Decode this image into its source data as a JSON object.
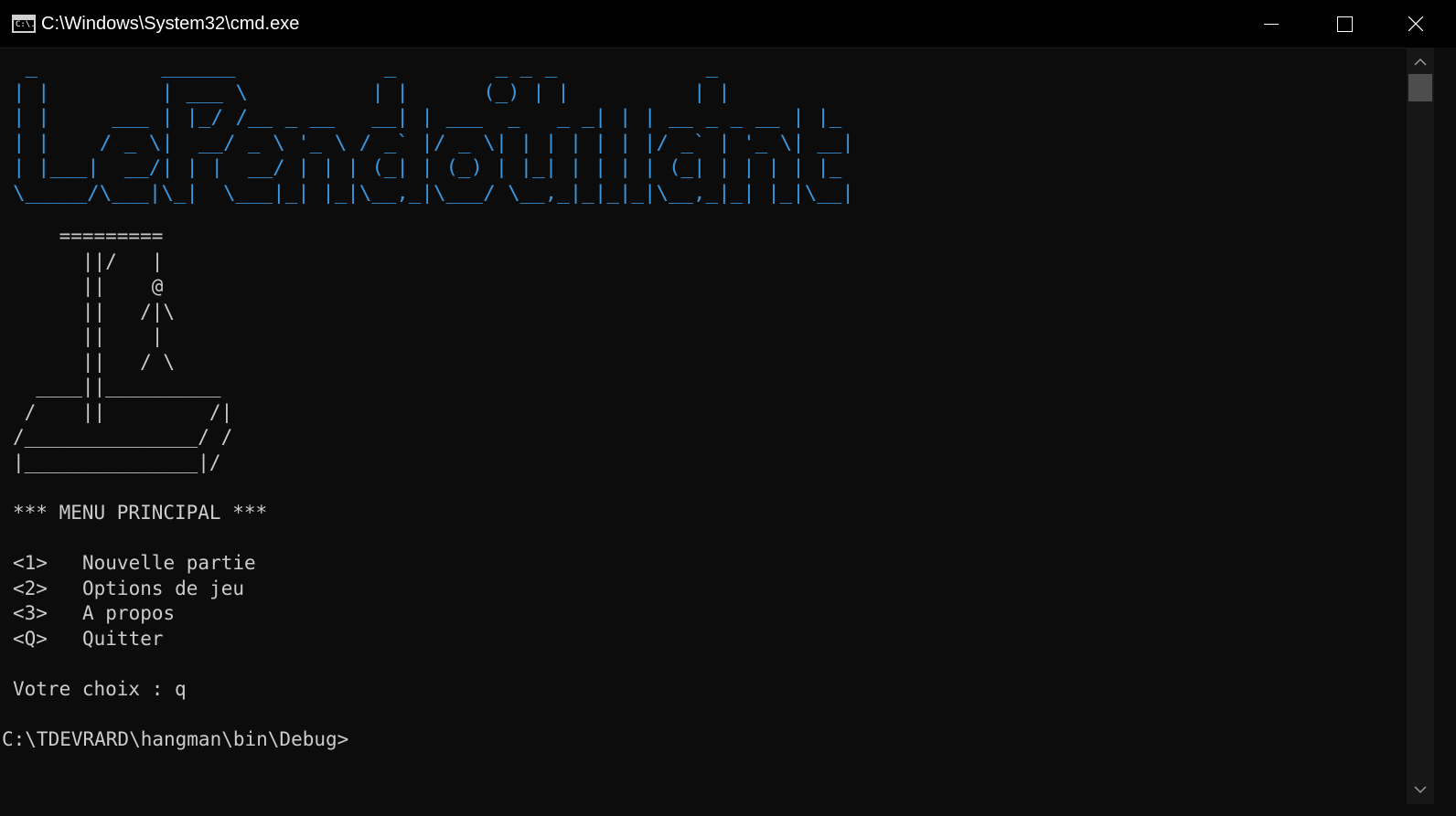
{
  "window": {
    "title": "C:\\Windows\\System32\\cmd.exe",
    "icon": "cmd-icon",
    "icon_glyph": "C:\\.",
    "controls": [
      "minimize-icon",
      "maximize-icon",
      "close-icon"
    ]
  },
  "console": {
    "banner": " _          ______            _        _ _ _            _   \n| |         | ___ \\          | |      (_) | |          | |  \n| |     ___ | |_/ /__ _ __   __| | ___  _   _ _| | | __ _ _ __ | |_ \n| |    / _ \\|  __/ _ \\ '_ \\ / _` |/ _ \\| | | | | | |/ _` | '_ \\| __|\n| |___|  __/| | |  __/ | | | (_| | (_) | |_| | | | | (_| | | | | |_ \n\\_____/\\___|\\_|  \\___|_| |_|\\__,_|\\___/ \\__,_|_|_|_|\\__,_|_| |_|\\__|",
    "banner_color": "#3a96dd",
    "gallows": "    =========\n      ||/   |\n      ||    @\n      ||   /|\\\n      ||    |\n      ||   / \\\n  ____||__________\n /    ||         /|\n/_______________/ /\n|_______________|/",
    "menu_title": "*** MENU PRINCIPAL ***",
    "menu_items": [
      {
        "key": "<1>",
        "label": "Nouvelle partie"
      },
      {
        "key": "<2>",
        "label": "Options de jeu"
      },
      {
        "key": "<3>",
        "label": "A propos"
      },
      {
        "key": "<Q>",
        "label": "Quitter"
      }
    ],
    "prompt": "Votre choix : q",
    "cmd_prompt": "C:\\TDEVRARD\\hangman\\bin\\Debug>",
    "text_color": "#cccccc",
    "background": "#0c0c0c"
  }
}
